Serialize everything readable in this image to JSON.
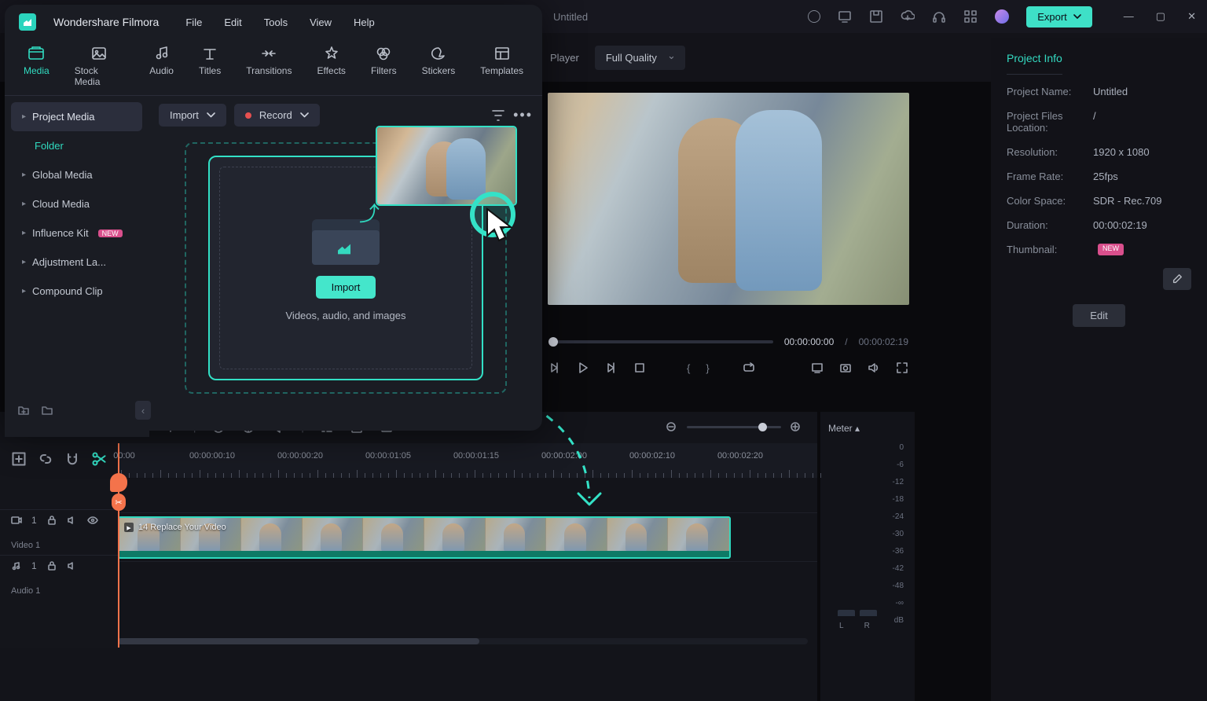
{
  "window": {
    "title": "Untitled"
  },
  "toolbar": {
    "export": "Export"
  },
  "subbar": {
    "player": "Player",
    "quality": "Full Quality"
  },
  "project_info": {
    "header": "Project Info",
    "name_k": "Project Name:",
    "name_v": "Untitled",
    "files_k": "Project Files Location:",
    "files_v": "/",
    "res_k": "Resolution:",
    "res_v": "1920 x 1080",
    "fps_k": "Frame Rate:",
    "fps_v": "25fps",
    "cs_k": "Color Space:",
    "cs_v": "SDR - Rec.709",
    "dur_k": "Duration:",
    "dur_v": "00:00:02:19",
    "thumb_k": "Thumbnail:",
    "thumb_badge": "NEW",
    "edit": "Edit"
  },
  "app": {
    "name": "Wondershare Filmora"
  },
  "menubar": {
    "file": "File",
    "edit": "Edit",
    "tools": "Tools",
    "view": "View",
    "help": "Help"
  },
  "tabs": {
    "media": "Media",
    "stock": "Stock Media",
    "audio": "Audio",
    "titles": "Titles",
    "transitions": "Transitions",
    "effects": "Effects",
    "filters": "Filters",
    "stickers": "Stickers",
    "templates": "Templates"
  },
  "side": {
    "project_media": "Project Media",
    "folder": "Folder",
    "global": "Global Media",
    "cloud": "Cloud Media",
    "influence": "Influence Kit",
    "influence_badge": "NEW",
    "adjust": "Adjustment La...",
    "compound": "Compound Clip"
  },
  "media_toolbar": {
    "import": "Import",
    "record": "Record"
  },
  "dropzone": {
    "import": "Import",
    "hint": "Videos, audio, and images"
  },
  "preview": {
    "cur": "00:00:00:00",
    "sep": "/",
    "dur": "00:00:02:19"
  },
  "timeline": {
    "marks": [
      "00:00",
      "00:00:00:10",
      "00:00:00:20",
      "00:00:01:05",
      "00:00:01:15",
      "00:00:02:00",
      "00:00:02:10",
      "00:00:02:20"
    ],
    "clip_label": "14 Replace Your Video",
    "video_track": "Video 1",
    "audio_track": "Audio 1",
    "track_num": "1"
  },
  "meter": {
    "title": "Meter ▴",
    "levels": [
      "0",
      "-6",
      "-12",
      "-18",
      "-24",
      "-30",
      "-36",
      "-42",
      "-48",
      "-∞",
      "dB"
    ],
    "L": "L",
    "R": "R"
  }
}
